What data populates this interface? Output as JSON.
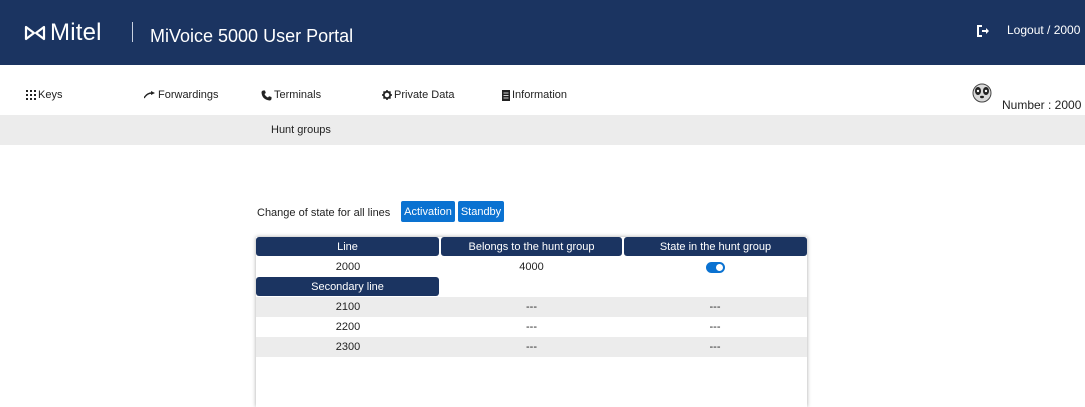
{
  "header": {
    "brand": "Mitel",
    "app_title": "MiVoice 5000 User Portal",
    "logout_label": "Logout / 2000"
  },
  "nav": {
    "items": [
      {
        "label": "Keys",
        "icon": "keypad-icon"
      },
      {
        "label": "Forwardings",
        "icon": "forward-arrow-icon"
      },
      {
        "label": "Terminals",
        "icon": "phone-icon"
      },
      {
        "label": "Private Data",
        "icon": "gear-icon"
      },
      {
        "label": "Information",
        "icon": "document-icon"
      }
    ],
    "number_label": "Number : 2000"
  },
  "subnav": {
    "active": "Hunt groups"
  },
  "state_change": {
    "label": "Change of state for all lines",
    "activation_label": "Activation",
    "standby_label": "Standby"
  },
  "table": {
    "headers": [
      "Line",
      "Belongs to the hunt group",
      "State in the hunt group"
    ],
    "main_row": {
      "line": "2000",
      "group": "4000",
      "state": "on"
    },
    "secondary_header": "Secondary line",
    "secondary_rows": [
      {
        "line": "2100",
        "group": "---",
        "state": "---"
      },
      {
        "line": "2200",
        "group": "---",
        "state": "---"
      },
      {
        "line": "2300",
        "group": "---",
        "state": "---"
      }
    ]
  },
  "colors": {
    "header_bg": "#1b3461",
    "accent": "#0a72d1",
    "row_alt": "#ececec"
  }
}
